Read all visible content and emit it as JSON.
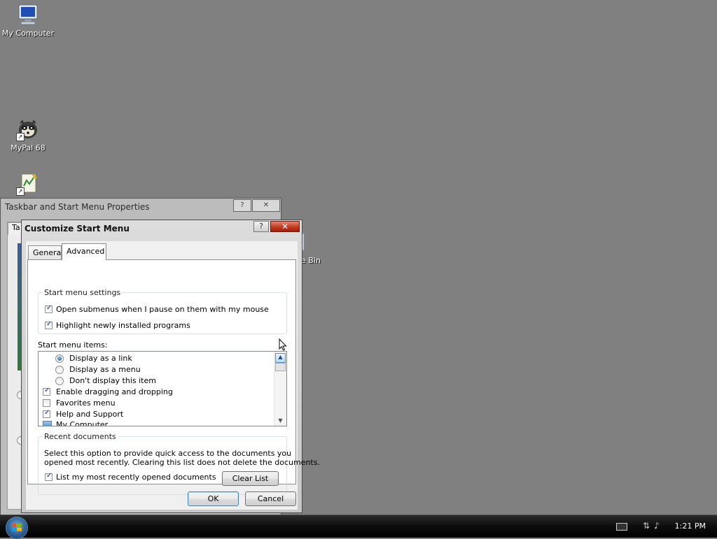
{
  "desktop": {
    "icons": [
      {
        "label": "My Computer",
        "icon": "computer-icon"
      },
      {
        "label": "MyPal 68",
        "icon": "raccoon-browser-icon"
      },
      {
        "label": "",
        "icon": "app-shortcut-icon"
      },
      {
        "label": "e Bin",
        "icon": "recycle-bin-icon"
      }
    ]
  },
  "background_window": {
    "title": "Taskbar and Start Menu Properties",
    "help_label": "?",
    "close_label": "✕",
    "tab_fragment": "Ta"
  },
  "dialog": {
    "title": "Customize Start Menu",
    "help_label": "?",
    "close_label": "✕",
    "tabs": [
      {
        "label": "General",
        "active": false
      },
      {
        "label": "Advanced",
        "active": true
      }
    ],
    "settings_group": {
      "legend": "Start menu settings",
      "options": [
        {
          "label": "Open submenus when I pause on them with my mouse",
          "checked": true
        },
        {
          "label": "Highlight newly installed programs",
          "checked": true
        }
      ]
    },
    "items_label": "Start menu items:",
    "items": [
      {
        "type": "radio",
        "label": "Display as a link",
        "checked": true
      },
      {
        "type": "radio",
        "label": "Display as a menu",
        "checked": false
      },
      {
        "type": "radio",
        "label": "Don't display this item",
        "checked": false
      },
      {
        "type": "checkbox",
        "label": "Enable dragging and dropping",
        "checked": true
      },
      {
        "type": "checkbox",
        "label": "Favorites menu",
        "checked": false
      },
      {
        "type": "checkbox",
        "label": "Help and Support",
        "checked": true
      },
      {
        "type": "icon",
        "label": "My Computer",
        "icon": "computer-small-icon"
      }
    ],
    "recent_group": {
      "legend": "Recent documents",
      "description_line1": "Select this option to provide quick access to the documents you",
      "description_line2": "opened most recently.  Clearing this list does not delete the documents.",
      "checkbox_label": "List my most recently opened documents",
      "checkbox_checked": true,
      "clear_button": "Clear List"
    },
    "ok_button": "OK",
    "cancel_button": "Cancel"
  },
  "taskbar": {
    "clock": "1:21 PM",
    "tray_icons": [
      "keyboard-icon",
      "network-icon",
      "volume-icon"
    ]
  },
  "colors": {
    "desktop": "#808080",
    "taskbar": "#0d0d0d",
    "accent": "#3c7fb1",
    "close_red": "#c23a21"
  }
}
